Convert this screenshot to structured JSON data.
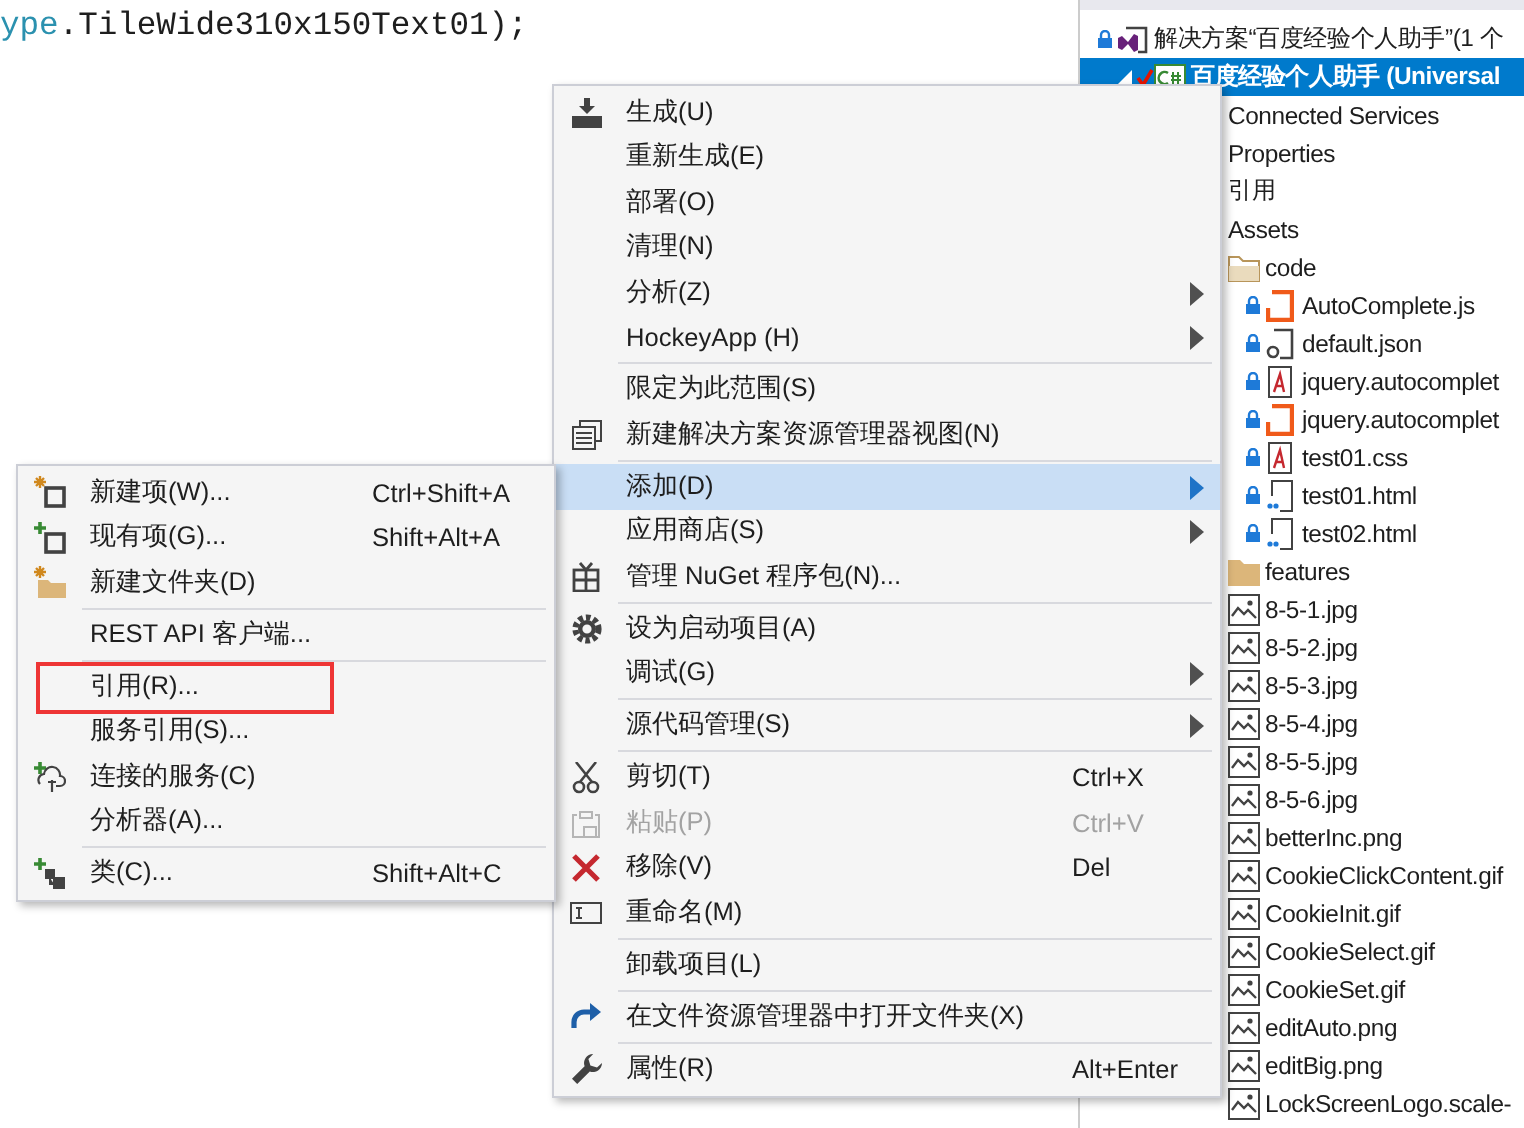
{
  "editor": {
    "code_tokens": [
      {
        "text": "ype",
        "kind": "type"
      },
      {
        "text": ".TileWide310x150Text01);",
        "kind": "plain"
      }
    ]
  },
  "solution_explorer": {
    "items": [
      {
        "label": "解决方案“百度经验个人助手”(1 个",
        "kind": "solution",
        "locked": true,
        "selected": false,
        "children": [
          {
            "label": "百度经验个人助手 (Universal",
            "kind": "project",
            "selected": true,
            "expanded": true,
            "children": [
              {
                "label": "Connected Services",
                "selected": false
              },
              {
                "label": "Properties",
                "selected": false
              },
              {
                "label": "引用",
                "selected": false
              },
              {
                "label": "Assets",
                "selected": false,
                "children": [
                  {
                    "label": "code",
                    "kind": "folder_open",
                    "selected": false,
                    "children": [
                      {
                        "label": "AutoComplete.js",
                        "kind": "js",
                        "locked": true,
                        "selected": false
                      },
                      {
                        "label": "default.json",
                        "kind": "json",
                        "locked": true,
                        "selected": false
                      },
                      {
                        "label": "jquery.autocomplet",
                        "kind": "css",
                        "locked": true,
                        "selected": false
                      },
                      {
                        "label": "jquery.autocomplet",
                        "kind": "js",
                        "locked": true,
                        "selected": false
                      },
                      {
                        "label": "test01.css",
                        "kind": "css",
                        "locked": true,
                        "selected": false
                      },
                      {
                        "label": "test01.html",
                        "kind": "html",
                        "locked": true,
                        "selected": false
                      },
                      {
                        "label": "test02.html",
                        "kind": "html",
                        "locked": true,
                        "selected": false
                      }
                    ]
                  },
                  {
                    "label": "features",
                    "kind": "folder",
                    "selected": false
                  },
                  {
                    "label": "8-5-1.jpg",
                    "kind": "image",
                    "selected": false
                  },
                  {
                    "label": "8-5-2.jpg",
                    "kind": "image",
                    "selected": false
                  },
                  {
                    "label": "8-5-3.jpg",
                    "kind": "image",
                    "selected": false
                  },
                  {
                    "label": "8-5-4.jpg",
                    "kind": "image",
                    "selected": false
                  },
                  {
                    "label": "8-5-5.jpg",
                    "kind": "image",
                    "selected": false
                  },
                  {
                    "label": "8-5-6.jpg",
                    "kind": "image",
                    "selected": false
                  },
                  {
                    "label": "betterInc.png",
                    "kind": "image",
                    "selected": false
                  },
                  {
                    "label": "CookieClickContent.gif",
                    "kind": "image",
                    "selected": false
                  },
                  {
                    "label": "CookieInit.gif",
                    "kind": "image",
                    "selected": false
                  },
                  {
                    "label": "CookieSelect.gif",
                    "kind": "image",
                    "selected": false
                  },
                  {
                    "label": "CookieSet.gif",
                    "kind": "image",
                    "selected": false
                  },
                  {
                    "label": "editAuto.png",
                    "kind": "image",
                    "selected": false
                  },
                  {
                    "label": "editBig.png",
                    "kind": "image",
                    "selected": false
                  },
                  {
                    "label": "LockScreenLogo.scale-",
                    "kind": "image",
                    "selected": false
                  }
                ]
              }
            ]
          }
        ]
      }
    ]
  },
  "context_menu": {
    "items": [
      {
        "kind": "item",
        "label": "生成(U)",
        "submenu": false,
        "disabled": false,
        "selected": false
      },
      {
        "kind": "item",
        "label": "重新生成(E)",
        "submenu": false,
        "disabled": false,
        "selected": false
      },
      {
        "kind": "item",
        "label": "部署(O)",
        "submenu": false,
        "disabled": false,
        "selected": false
      },
      {
        "kind": "item",
        "label": "清理(N)",
        "submenu": false,
        "disabled": false,
        "selected": false
      },
      {
        "kind": "item",
        "label": "分析(Z)",
        "submenu": true,
        "disabled": false,
        "selected": false
      },
      {
        "kind": "item",
        "label": "HockeyApp (H)",
        "submenu": true,
        "disabled": false,
        "selected": false
      },
      {
        "kind": "separator"
      },
      {
        "kind": "item",
        "label": "限定为此范围(S)",
        "submenu": false,
        "disabled": false,
        "selected": false
      },
      {
        "kind": "item",
        "label": "新建解决方案资源管理器视图(N)",
        "submenu": false,
        "disabled": false,
        "selected": false
      },
      {
        "kind": "separator"
      },
      {
        "kind": "item",
        "label": "添加(D)",
        "submenu": true,
        "disabled": false,
        "selected": true
      },
      {
        "kind": "item",
        "label": "应用商店(S)",
        "submenu": true,
        "disabled": false,
        "selected": false
      },
      {
        "kind": "item",
        "label": "管理 NuGet 程序包(N)...",
        "submenu": false,
        "disabled": false,
        "selected": false
      },
      {
        "kind": "separator"
      },
      {
        "kind": "item",
        "label": "设为启动项目(A)",
        "submenu": false,
        "disabled": false,
        "selected": false
      },
      {
        "kind": "item",
        "label": "调试(G)",
        "submenu": true,
        "disabled": false,
        "selected": false
      },
      {
        "kind": "separator"
      },
      {
        "kind": "item",
        "label": "源代码管理(S)",
        "submenu": true,
        "disabled": false,
        "selected": false
      },
      {
        "kind": "separator"
      },
      {
        "kind": "item",
        "label": "剪切(T)",
        "shortcut": "Ctrl+X",
        "submenu": false,
        "disabled": false,
        "selected": false
      },
      {
        "kind": "item",
        "label": "粘贴(P)",
        "shortcut": "Ctrl+V",
        "submenu": false,
        "disabled": true,
        "selected": false
      },
      {
        "kind": "item",
        "label": "移除(V)",
        "shortcut": "Del",
        "submenu": false,
        "disabled": false,
        "selected": false
      },
      {
        "kind": "item",
        "label": "重命名(M)",
        "submenu": false,
        "disabled": false,
        "selected": false
      },
      {
        "kind": "separator"
      },
      {
        "kind": "item",
        "label": "卸载项目(L)",
        "submenu": false,
        "disabled": false,
        "selected": false
      },
      {
        "kind": "separator"
      },
      {
        "kind": "item",
        "label": "在文件资源管理器中打开文件夹(X)",
        "submenu": false,
        "disabled": false,
        "selected": false
      },
      {
        "kind": "separator"
      },
      {
        "kind": "item",
        "label": "属性(R)",
        "shortcut": "Alt+Enter",
        "submenu": false,
        "disabled": false,
        "selected": false
      }
    ]
  },
  "add_submenu": {
    "items": [
      {
        "kind": "item",
        "label": "新建项(W)...",
        "shortcut": "Ctrl+Shift+A",
        "submenu": false,
        "disabled": false,
        "selected": false,
        "marked": false
      },
      {
        "kind": "item",
        "label": "现有项(G)...",
        "shortcut": "Shift+Alt+A",
        "submenu": false,
        "disabled": false,
        "selected": false,
        "marked": false
      },
      {
        "kind": "item",
        "label": "新建文件夹(D)",
        "submenu": false,
        "disabled": false,
        "selected": false,
        "marked": false
      },
      {
        "kind": "separator"
      },
      {
        "kind": "item",
        "label": "REST API 客户端...",
        "submenu": false,
        "disabled": false,
        "selected": false,
        "marked": false
      },
      {
        "kind": "separator"
      },
      {
        "kind": "item",
        "label": "引用(R)...",
        "submenu": false,
        "disabled": false,
        "selected": false,
        "marked": true
      },
      {
        "kind": "item",
        "label": "服务引用(S)...",
        "submenu": false,
        "disabled": false,
        "selected": false,
        "marked": false
      },
      {
        "kind": "item",
        "label": "连接的服务(C)",
        "submenu": false,
        "disabled": false,
        "selected": false,
        "marked": false
      },
      {
        "kind": "item",
        "label": "分析器(A)...",
        "submenu": false,
        "disabled": false,
        "selected": false,
        "marked": false
      },
      {
        "kind": "separator"
      },
      {
        "kind": "item",
        "label": "类(C)...",
        "shortcut": "Shift+Alt+C",
        "submenu": false,
        "disabled": false,
        "selected": false,
        "marked": false
      }
    ]
  }
}
